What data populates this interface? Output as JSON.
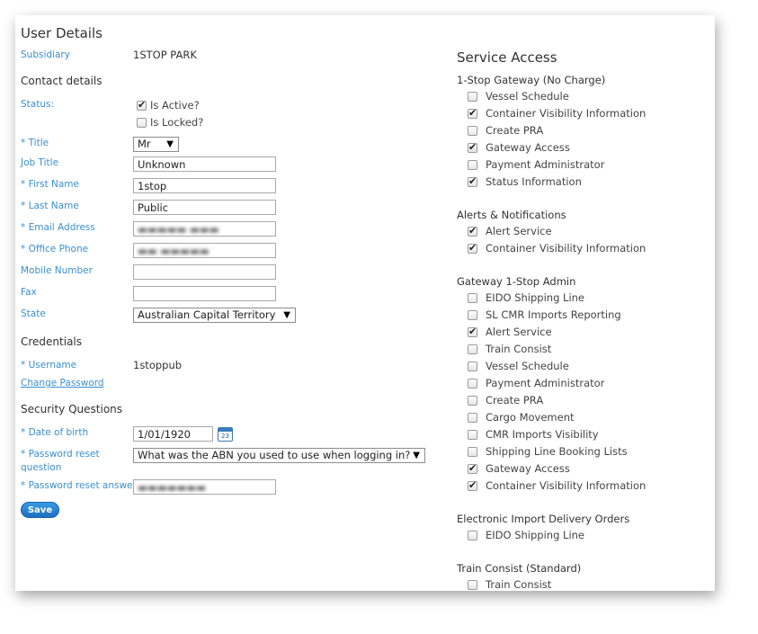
{
  "left": {
    "title": "User Details",
    "subsidiary_label": "Subsidiary",
    "subsidiary_value": "1STOP PARK",
    "contact_heading": "Contact details",
    "status_label": "Status:",
    "is_active_label": "Is Active?",
    "is_active_checked": true,
    "is_locked_label": "Is Locked?",
    "is_locked_checked": false,
    "title_label": "* Title",
    "title_value": "Mr",
    "job_title_label": "Job Title",
    "job_title_value": "Unknown",
    "first_name_label": "* First Name",
    "first_name_value": "1stop",
    "last_name_label": "* Last Name",
    "last_name_value": "Public",
    "email_label": "* Email Address",
    "email_value": "",
    "office_phone_label": "* Office Phone",
    "office_phone_value": "",
    "mobile_label": "Mobile Number",
    "mobile_value": "",
    "fax_label": "Fax",
    "fax_value": "",
    "state_label": "State",
    "state_value": "Australian Capital Territory",
    "credentials_heading": "Credentials",
    "username_label": "* Username",
    "username_value": "1stoppub",
    "change_password_link": "Change Password",
    "security_heading": "Security Questions",
    "dob_label": "* Date of birth",
    "dob_value": "1/01/1920",
    "calendar_day": "23",
    "reset_question_label_1": "* Password reset",
    "reset_question_label_2": "question",
    "reset_question_value": "What was the ABN you used to use when logging in?",
    "reset_answer_label": "* Password reset answer",
    "reset_answer_value": "",
    "save_button": "Save"
  },
  "right": {
    "title": "Service Access",
    "groups": [
      {
        "name": "1-Stop Gateway (No Charge)",
        "items": [
          {
            "label": "Vessel Schedule",
            "checked": false
          },
          {
            "label": "Container Visibility Information",
            "checked": true
          },
          {
            "label": "Create PRA",
            "checked": false
          },
          {
            "label": "Gateway Access",
            "checked": true
          },
          {
            "label": "Payment Administrator",
            "checked": false
          },
          {
            "label": "Status Information",
            "checked": true
          }
        ]
      },
      {
        "name": "Alerts & Notifications",
        "items": [
          {
            "label": "Alert Service",
            "checked": true
          },
          {
            "label": "Container Visibility Information",
            "checked": true
          }
        ]
      },
      {
        "name": "Gateway 1-Stop Admin",
        "items": [
          {
            "label": "EIDO Shipping Line",
            "checked": false
          },
          {
            "label": "SL CMR Imports Reporting",
            "checked": false
          },
          {
            "label": "Alert Service",
            "checked": true
          },
          {
            "label": "Train Consist",
            "checked": false
          },
          {
            "label": "Vessel Schedule",
            "checked": false
          },
          {
            "label": "Payment Administrator",
            "checked": false
          },
          {
            "label": "Create PRA",
            "checked": false
          },
          {
            "label": "Cargo Movement",
            "checked": false
          },
          {
            "label": "CMR Imports Visibility",
            "checked": false
          },
          {
            "label": "Shipping Line Booking Lists",
            "checked": false
          },
          {
            "label": "Gateway Access",
            "checked": true
          },
          {
            "label": "Container Visibility Information",
            "checked": true
          }
        ]
      },
      {
        "name": "Electronic Import Delivery Orders",
        "items": [
          {
            "label": "EIDO Shipping Line",
            "checked": false
          }
        ]
      },
      {
        "name": "Train Consist (Standard)",
        "items": [
          {
            "label": "Train Consist",
            "checked": false
          }
        ]
      }
    ]
  }
}
